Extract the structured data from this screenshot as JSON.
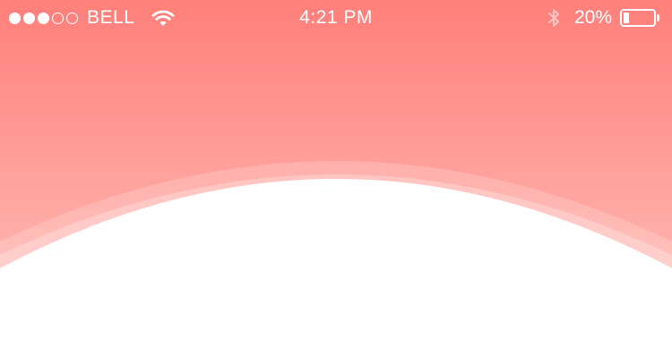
{
  "status_bar": {
    "signal": {
      "filled_dots": 3,
      "total_dots": 5
    },
    "carrier": "BELL",
    "wifi_icon": "wifi-icon",
    "time": "4:21 PM",
    "bluetooth_icon": "bluetooth-icon",
    "battery_percent_label": "20%",
    "battery_level": 0.2
  },
  "colors": {
    "header_top": "#FF7F7A",
    "header_bottom": "#FFB3AE",
    "content_background": "#FFFFFF",
    "status_text": "#FFFFFF"
  }
}
